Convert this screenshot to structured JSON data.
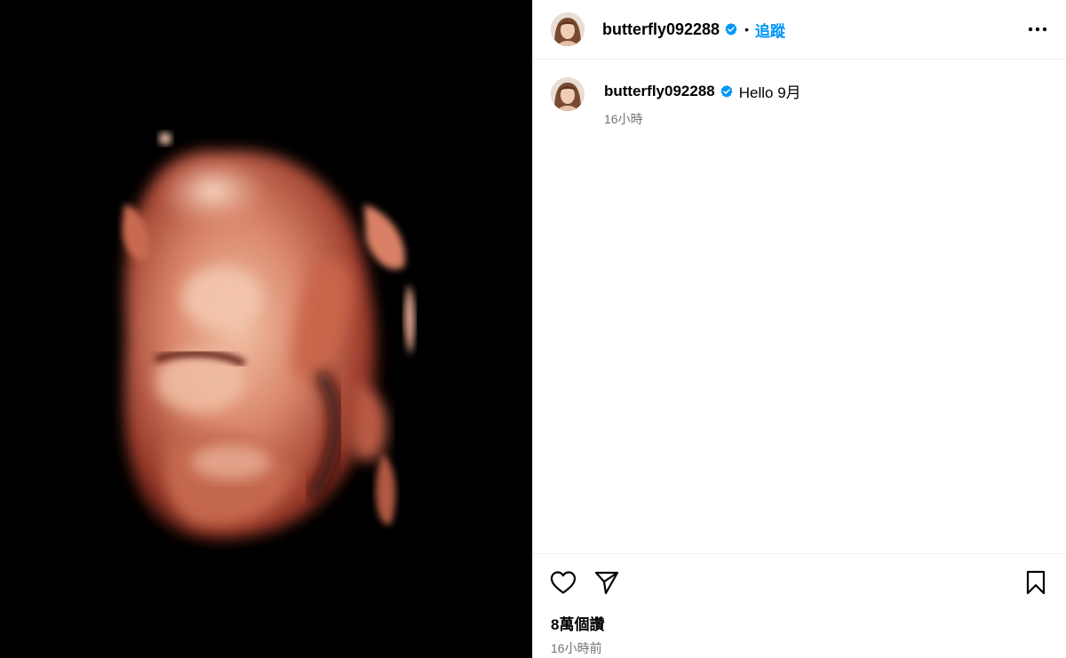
{
  "post": {
    "username": "butterfly092288",
    "follow_label": "追蹤",
    "dot": "•",
    "caption_text": "Hello 9月",
    "caption_time": "16小時",
    "views": "8萬個讚",
    "posted_time": "16小時前"
  },
  "colors": {
    "accent": "#0095f6",
    "verified": "#0095f6",
    "secondary_text": "#737373",
    "media_background": "#000000"
  },
  "icons": {
    "verified": "verified-badge-icon",
    "more": "more-options-icon",
    "like": "heart-icon",
    "share": "paper-plane-icon",
    "save": "bookmark-icon"
  }
}
